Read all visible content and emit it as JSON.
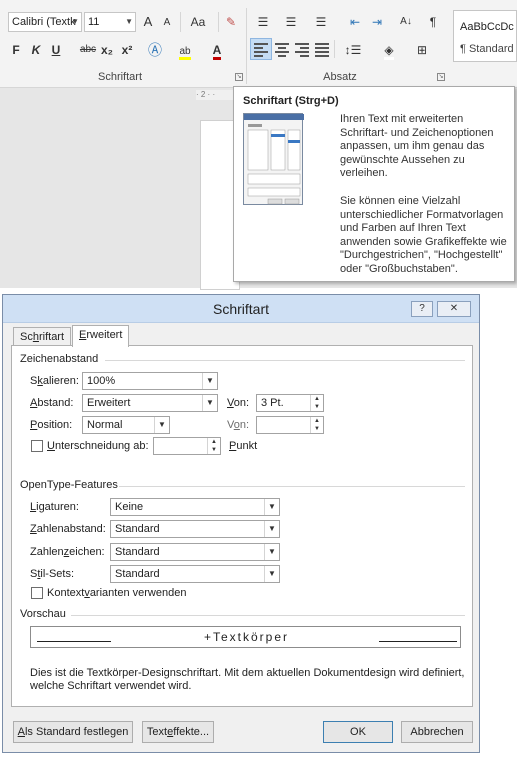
{
  "ribbon": {
    "font_name": "Calibri (Textk",
    "font_size": "11",
    "grow_font": "A",
    "shrink_font": "A",
    "change_case": "Aa",
    "bold": "F",
    "italic": "K",
    "underline": "U",
    "strikethrough": "abc",
    "subscript": "x₂",
    "superscript": "x²",
    "schriftart_label": "Schriftart",
    "absatz_label": "Absatz",
    "pilcrow": "¶",
    "styles_sample": "AaBbCcDc",
    "styles_name": "¶ Standard"
  },
  "ruler_text": "· 2 · ·",
  "tooltip": {
    "title": "Schriftart (Strg+D)",
    "para1": "Ihren Text mit erweiterten Schriftart- und Zeichenoptionen anpassen, um ihm genau das gewünschte Aussehen zu verleihen.",
    "para2": "Sie können eine Vielzahl unterschiedlicher Formatvorlagen und Farben auf Ihren Text anwenden sowie Grafikeffekte wie \"Durchgestrichen\", \"Hochgestellt\" oder \"Großbuchstaben\"."
  },
  "dialog": {
    "title": "Schriftart",
    "help_button": "?",
    "close_button": "✕",
    "tabs": [
      {
        "pre": "Sc",
        "key": "h",
        "post": "riftart"
      },
      {
        "pre": "",
        "key": "E",
        "post": "rweitert"
      }
    ],
    "zeichenabstand": {
      "heading": "Zeichenabstand",
      "skalieren_label": {
        "pre": "S",
        "key": "k",
        "post": "alieren:"
      },
      "skalieren_value": "100%",
      "abstand_label": {
        "pre": "",
        "key": "A",
        "post": "bstand:"
      },
      "abstand_value": "Erweitert",
      "abstand_von_label": {
        "pre": "",
        "key": "V",
        "post": "on:"
      },
      "abstand_von_value": "3 Pt.",
      "position_label": {
        "pre": "",
        "key": "P",
        "post": "osition:"
      },
      "position_value": "Normal",
      "position_von_label": {
        "pre": "V",
        "key": "o",
        "post": "n:"
      },
      "position_von_value": "",
      "kerning_label": {
        "pre": "",
        "key": "U",
        "post": "nterschneidung ab:"
      },
      "kerning_value": "",
      "punkt_label": {
        "pre": "",
        "key": "P",
        "post": "unkt"
      }
    },
    "opentype": {
      "heading": "OpenType-Features",
      "ligaturen_label": {
        "pre": "",
        "key": "L",
        "post": "igaturen:"
      },
      "ligaturen_value": "Keine",
      "zahlenabstand_label": {
        "pre": "",
        "key": "Z",
        "post": "ahlenabstand:"
      },
      "zahlenabstand_value": "Standard",
      "zahlenzeichen_label": {
        "pre": "Zahlen",
        "key": "z",
        "post": "eichen:"
      },
      "zahlenzeichen_value": "Standard",
      "stilsets_label": {
        "pre": "S",
        "key": "t",
        "post": "il-Sets:"
      },
      "stilsets_value": "Standard",
      "kontext_label": {
        "pre": "Kontext",
        "key": "v",
        "post": "arianten verwenden"
      }
    },
    "vorschau": {
      "heading": "Vorschau",
      "preview_text": "+Textkörper",
      "description": "Dies ist die Textkörper-Designschriftart. Mit dem aktuellen Dokumentdesign wird definiert, welche Schriftart verwendet wird."
    },
    "buttons": {
      "default": {
        "pre": "",
        "key": "A",
        "post": "ls Standard festlegen"
      },
      "effects": {
        "pre": "Text",
        "key": "e",
        "post": "ffekte..."
      },
      "ok": "OK",
      "cancel": "Abbrechen"
    }
  }
}
